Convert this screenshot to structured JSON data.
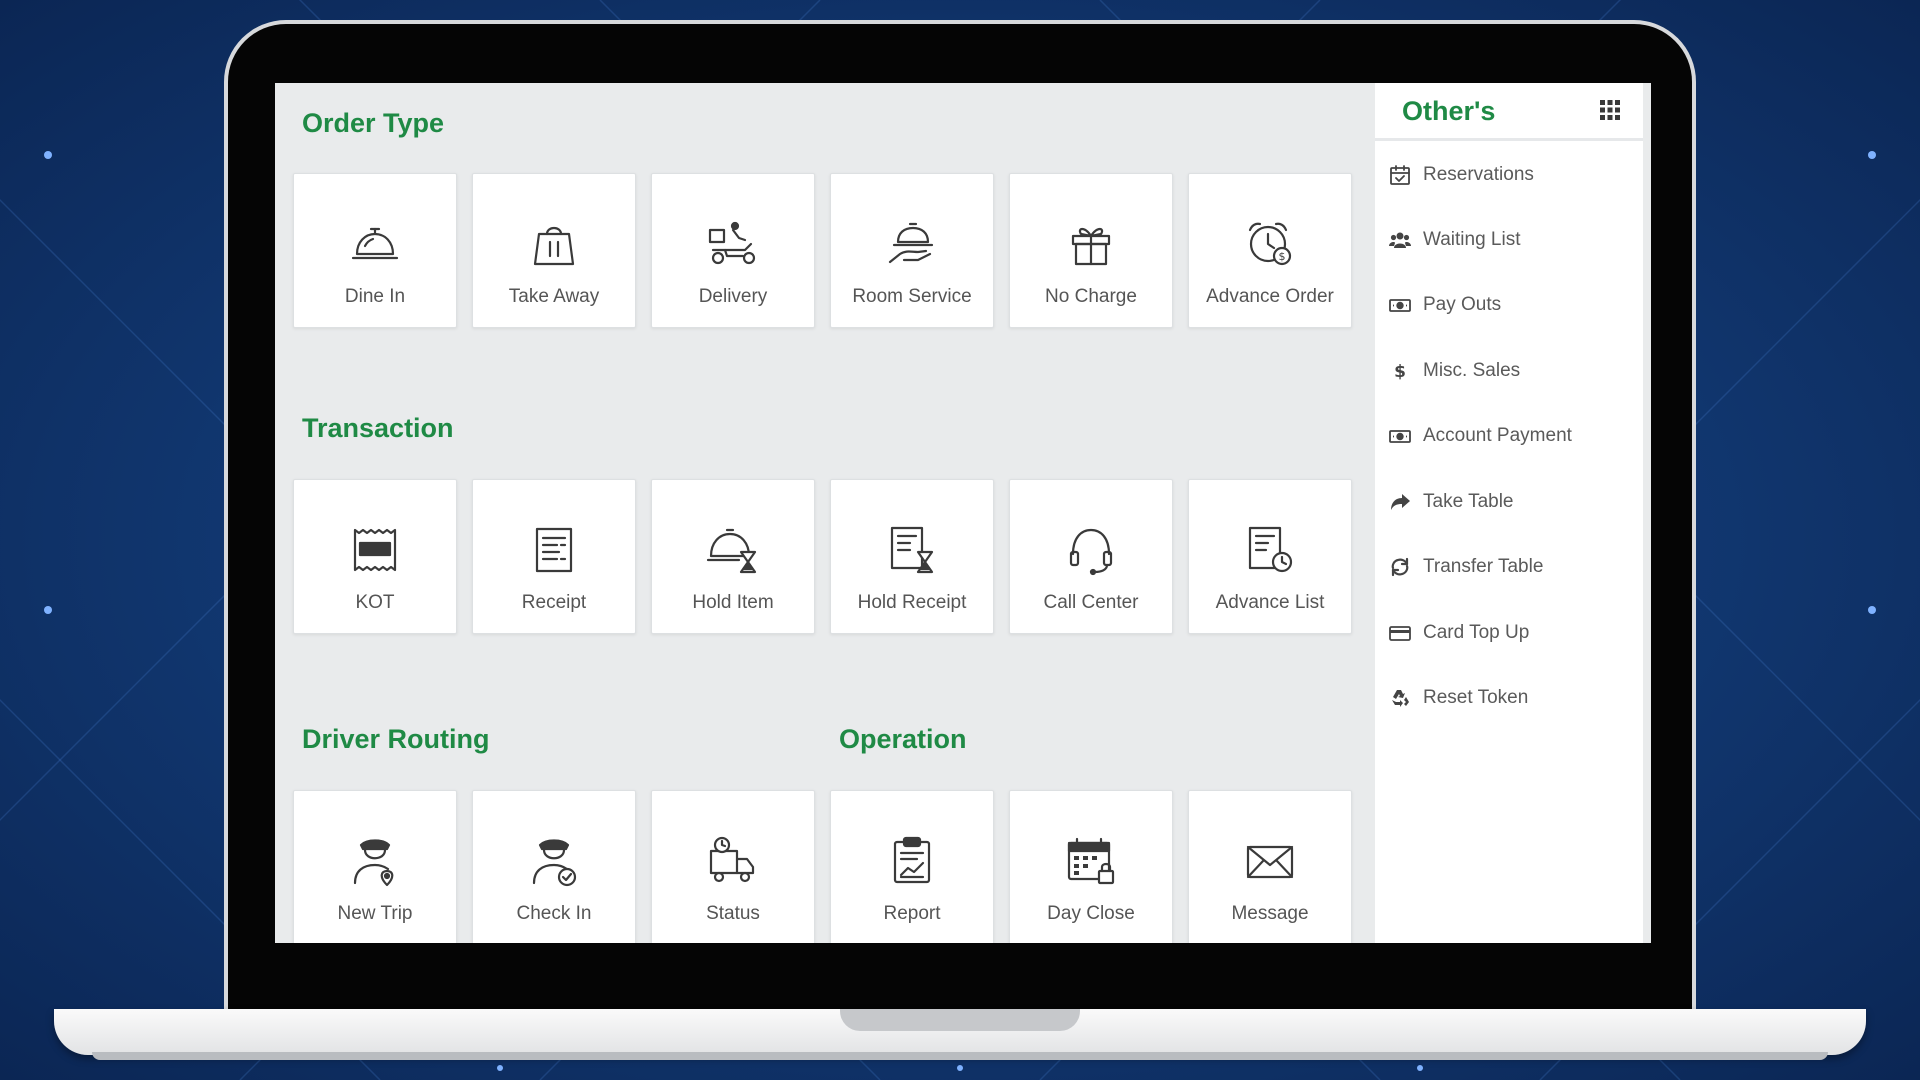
{
  "sections": {
    "order_type": {
      "title": "Order Type",
      "tiles": [
        {
          "label": "Dine In",
          "icon": "cloche-icon"
        },
        {
          "label": "Take Away",
          "icon": "shopping-bag-icon"
        },
        {
          "label": "Delivery",
          "icon": "delivery-scooter-icon"
        },
        {
          "label": "Room Service",
          "icon": "serving-hand-icon"
        },
        {
          "label": "No Charge",
          "icon": "gift-icon"
        },
        {
          "label": "Advance Order",
          "icon": "alarm-clock-dollar-icon"
        }
      ]
    },
    "transaction": {
      "title": "Transaction",
      "tiles": [
        {
          "label": "KOT",
          "icon": "ticket-icon"
        },
        {
          "label": "Receipt",
          "icon": "receipt-icon"
        },
        {
          "label": "Hold Item",
          "icon": "cloche-hourglass-icon"
        },
        {
          "label": "Hold Receipt",
          "icon": "receipt-hourglass-icon"
        },
        {
          "label": "Call Center",
          "icon": "headset-icon"
        },
        {
          "label": "Advance List",
          "icon": "list-clock-icon"
        }
      ]
    },
    "driver_routing": {
      "title": "Driver Routing",
      "tiles": [
        {
          "label": "New Trip",
          "icon": "driver-pin-icon"
        },
        {
          "label": "Check In",
          "icon": "driver-check-icon"
        },
        {
          "label": "Status",
          "icon": "truck-clock-icon"
        }
      ]
    },
    "operation": {
      "title": "Operation",
      "tiles": [
        {
          "label": "Report",
          "icon": "clipboard-chart-icon"
        },
        {
          "label": "Day Close",
          "icon": "calendar-lock-icon"
        },
        {
          "label": "Message",
          "icon": "envelope-icon"
        }
      ]
    }
  },
  "sidebar": {
    "title": "Other's",
    "menu_icon": "grid-icon",
    "items": [
      {
        "label": "Reservations",
        "icon": "calendar-check-icon"
      },
      {
        "label": "Waiting List",
        "icon": "users-icon"
      },
      {
        "label": "Pay Outs",
        "icon": "money-icon"
      },
      {
        "label": "Misc. Sales",
        "icon": "dollar-icon"
      },
      {
        "label": "Account Payment",
        "icon": "money-icon"
      },
      {
        "label": "Take Table",
        "icon": "share-arrow-icon"
      },
      {
        "label": "Transfer Table",
        "icon": "refresh-icon"
      },
      {
        "label": "Card Top Up",
        "icon": "credit-card-icon"
      },
      {
        "label": "Reset Token",
        "icon": "recycle-icon"
      }
    ]
  },
  "colors": {
    "accent_green": "#1f8a45",
    "screen_background": "#e9ebec",
    "tile_background": "#ffffff",
    "icon_stroke": "#3a3a3a",
    "label_text": "#555555",
    "bezel": "#050505",
    "backdrop_blue": "#123a75"
  }
}
